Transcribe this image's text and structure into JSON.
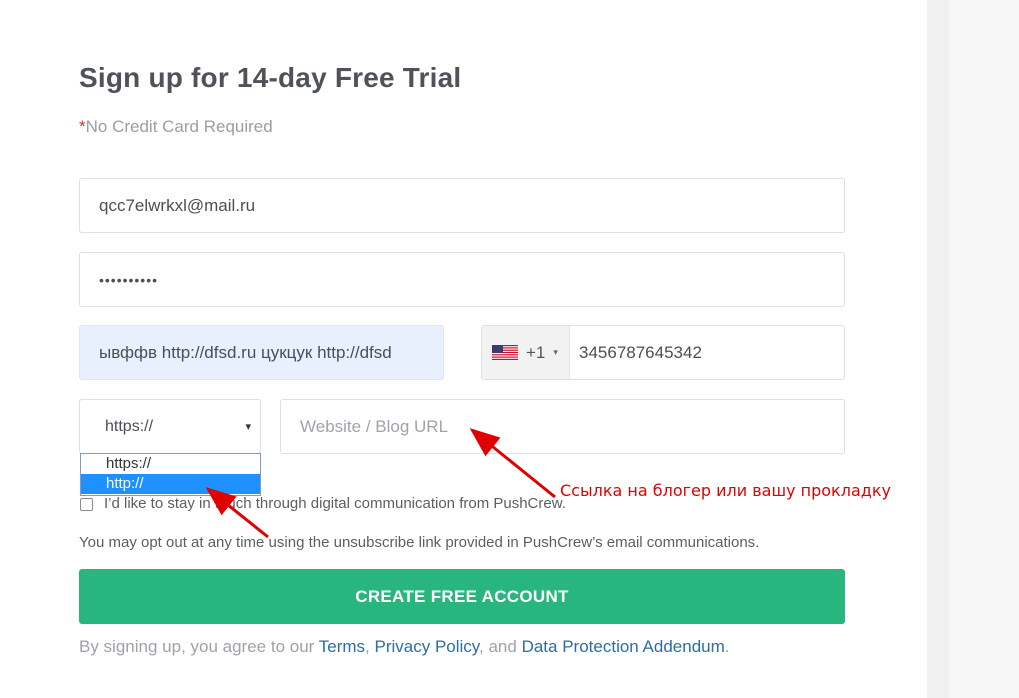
{
  "form": {
    "title": "Sign up for 14-day Free Trial",
    "subtitle_star": "*",
    "subtitle": "No Credit Card Required",
    "email_value": "qcc7elwrkxl@mail.ru",
    "password_value": "••••••••••",
    "name_value": "ывффв http://dfsd.ru цукцук http://dfsd",
    "phone": {
      "country_flag": "us-flag-icon",
      "dial_code": "+1",
      "caret": "▾",
      "number": "3456787645342"
    },
    "protocol": {
      "selected": "https://",
      "arrow": "▾",
      "options": [
        "https://",
        "http://"
      ],
      "highlighted_option": "http://"
    },
    "url_placeholder": "Website / Blog URL",
    "consent_label": "I’d like to stay in touch through digital communication from PushCrew.",
    "optout_text": "You may opt out at any time using the unsubscribe link provided in PushCrew’s email communications.",
    "cta_label": "CREATE FREE ACCOUNT",
    "legal": {
      "prefix": "By signing up, you agree to our ",
      "terms": "Terms",
      "sep1": ", ",
      "privacy": "Privacy Policy",
      "sep2": ", and ",
      "dpa": "Data Protection Addendum",
      "suffix": "."
    }
  },
  "annotation": {
    "text": "Ссылка на блогер или вашу прокладку",
    "color": "#e00000"
  },
  "colors": {
    "accent": "#28b67e",
    "link": "#2e6da4",
    "autofill": "#e8f0fe",
    "dropdown_highlight": "#1e90ff"
  }
}
